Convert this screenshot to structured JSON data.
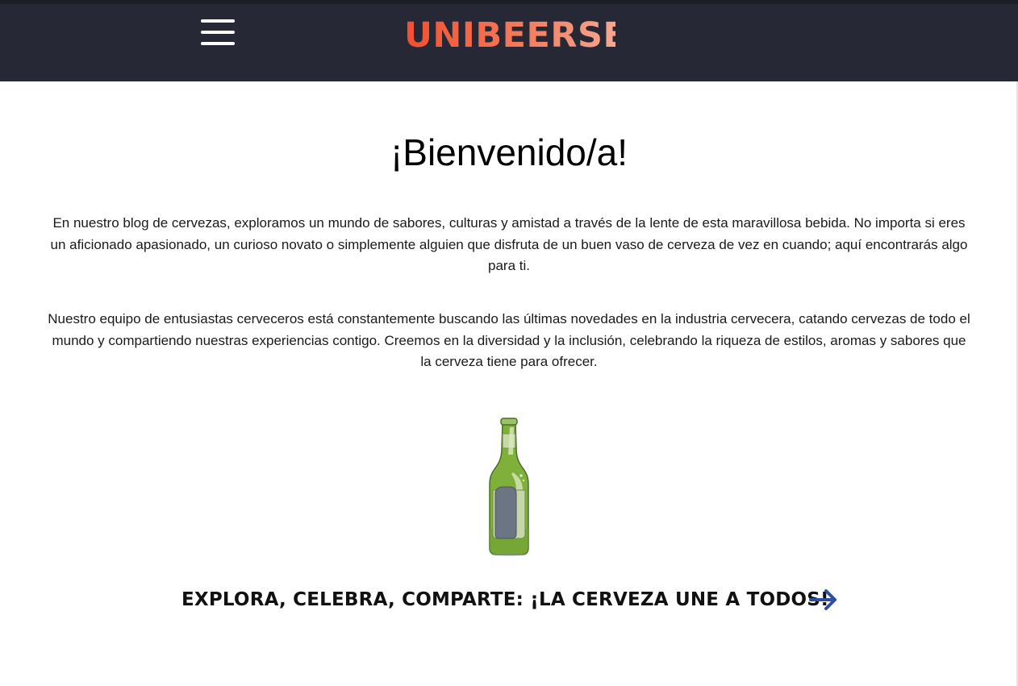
{
  "header": {
    "menu_icon": "hamburger-menu-icon",
    "logo_text": "UNIBEERSE",
    "logo_colors": [
      "#f24f2f",
      "#f37a5c",
      "#f5a890"
    ],
    "background": "#262835"
  },
  "main": {
    "title": "¡Bienvenido/a!",
    "paragraphs": [
      "En nuestro blog de cervezas, exploramos un mundo de sabores, culturas y amistad a través de la lente de esta maravillosa bebida. No importa si eres un aficionado apasionado, un curioso novato o simplemente alguien que disfruta de un buen vaso de cerveza de vez en cuando; aquí encontrarás algo para ti.",
      "Nuestro equipo de entusiastas cerveceros está constantemente buscando las últimas novedades en la industria cervecera, catando cervezas de todo el mundo y compartiendo nuestras experiencias contigo. Creemos en la diversidad y la inclusión, celebrando la riqueza de estilos, aromas y sabores que la cerveza tiene para ofrecer."
    ],
    "illustration": "beer-bottle-icon",
    "cta": {
      "text": "EXPLORA, CELEBRA, COMPARTE: ¡LA CERVEZA UNE A TODOS!",
      "icon": "arrow-right-icon",
      "arrow_color": "#2f4f9e"
    }
  }
}
